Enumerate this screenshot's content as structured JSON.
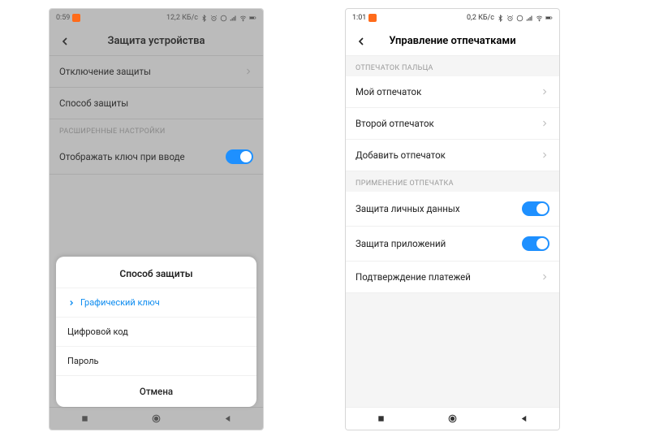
{
  "phone1": {
    "status": {
      "time": "0:59",
      "net": "12,2 КБ/с"
    },
    "header": {
      "title": "Защита устройства"
    },
    "rows": {
      "disable_protection": "Отключение защиты",
      "protection_method": "Способ защиты"
    },
    "section_advanced": "РАСШИРЕННЫЕ НАСТРОЙКИ",
    "show_key_label": "Отображать ключ при вводе",
    "sheet": {
      "title": "Способ защиты",
      "opt_pattern": "Графический ключ",
      "opt_pin": "Цифровой код",
      "opt_password": "Пароль",
      "cancel": "Отмена"
    }
  },
  "phone2": {
    "status": {
      "time": "1:01",
      "net": "0,2 КБ/с"
    },
    "header": {
      "title": "Управление отпечатками"
    },
    "section_fp": "ОТПЕЧАТОК ПАЛЬЦА",
    "rows": {
      "my_fp": "Мой отпечаток",
      "second_fp": "Второй отпечаток",
      "add_fp": "Добавить отпечаток"
    },
    "section_usage": "ПРИМЕНЕНИЕ ОТПЕЧАТКА",
    "usage_rows": {
      "personal": "Защита личных данных",
      "apps": "Защита приложений",
      "payments": "Подтверждение платежей"
    }
  }
}
